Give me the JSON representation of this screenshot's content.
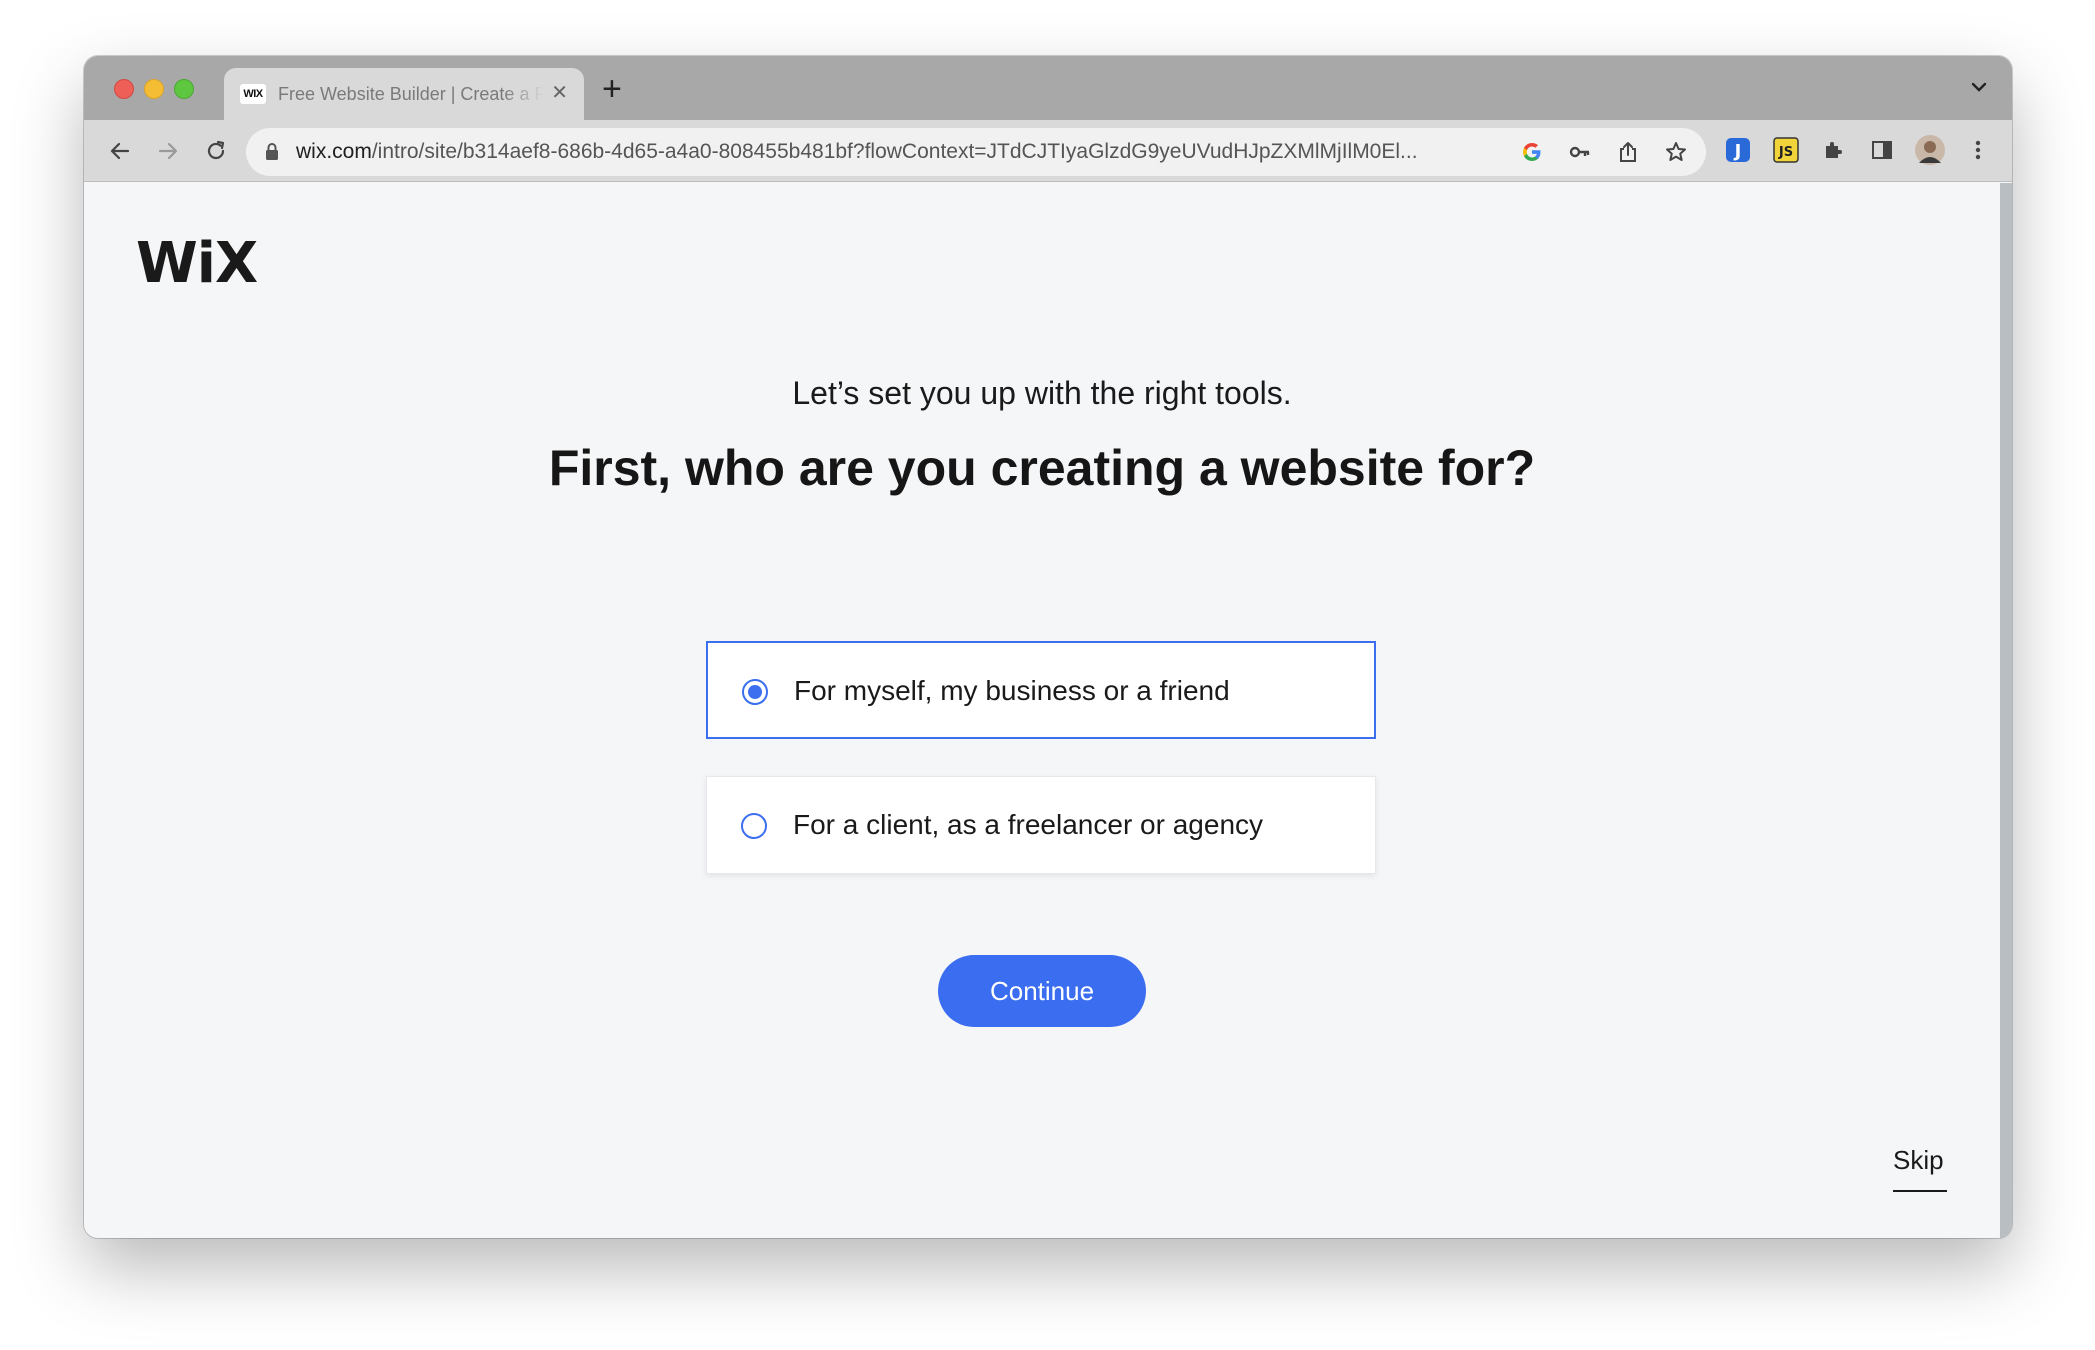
{
  "browser": {
    "tab": {
      "favicon_text": "WIX",
      "title": "Free Website Builder | Create a Free Website",
      "close_glyph": "✕"
    },
    "new_tab_glyph": "+",
    "url": {
      "host": "wix.com",
      "path": "/intro/site/b314aef8-686b-4d65-a4a0-808455b481bf?flowContext=JTdCJTIyaGlzdG9yeUVudHJpZXMlMjIlM0El..."
    },
    "icons": [
      "back-icon",
      "forward-icon",
      "reload-icon",
      "lock-icon",
      "google-icon",
      "key-icon",
      "share-icon",
      "star-icon",
      "extension-j-icon",
      "extension-js-icon",
      "puzzle-icon",
      "sidepanel-icon",
      "avatar",
      "kebab-menu-icon"
    ]
  },
  "page": {
    "logo": "WiX",
    "subtitle": "Let’s set you up with the right tools.",
    "title": "First, who are you creating a website for?",
    "options": [
      {
        "label": "For myself, my business or a friend",
        "selected": true
      },
      {
        "label": "For a client, as a freelancer or agency",
        "selected": false
      }
    ],
    "continue_label": "Continue",
    "skip_label": "Skip",
    "accent_color": "#3a6df0"
  }
}
